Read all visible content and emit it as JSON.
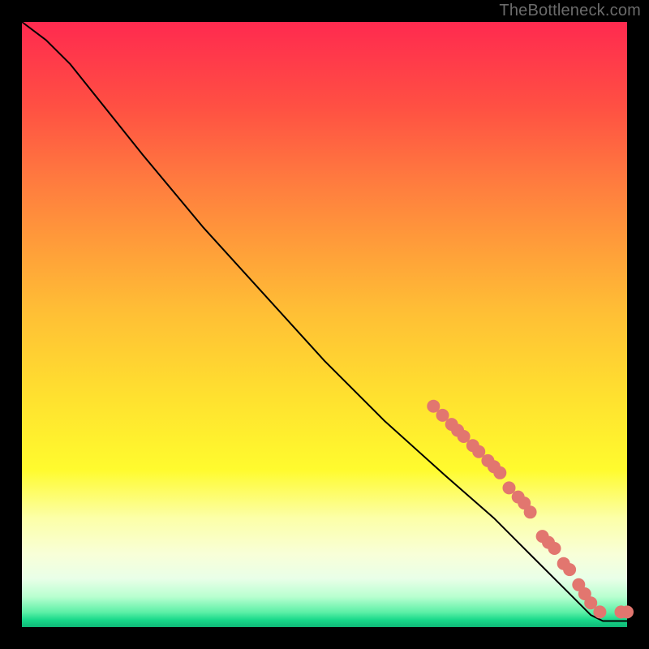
{
  "attribution": "TheBottleneck.com",
  "chart_data": {
    "type": "line",
    "xlim": [
      0,
      100
    ],
    "ylim": [
      0,
      100
    ],
    "title": "",
    "xlabel": "",
    "ylabel": "",
    "curve": [
      {
        "x": 0,
        "y": 100
      },
      {
        "x": 4,
        "y": 97
      },
      {
        "x": 8,
        "y": 93
      },
      {
        "x": 12,
        "y": 88
      },
      {
        "x": 20,
        "y": 78
      },
      {
        "x": 30,
        "y": 66
      },
      {
        "x": 40,
        "y": 55
      },
      {
        "x": 50,
        "y": 44
      },
      {
        "x": 60,
        "y": 34
      },
      {
        "x": 70,
        "y": 25
      },
      {
        "x": 78,
        "y": 18
      },
      {
        "x": 84,
        "y": 12
      },
      {
        "x": 90,
        "y": 6
      },
      {
        "x": 94,
        "y": 2
      },
      {
        "x": 96,
        "y": 1
      },
      {
        "x": 98,
        "y": 1
      },
      {
        "x": 100,
        "y": 1
      }
    ],
    "markers": [
      {
        "x": 68.0,
        "y": 36.5
      },
      {
        "x": 69.5,
        "y": 35.0
      },
      {
        "x": 71.0,
        "y": 33.5
      },
      {
        "x": 72.0,
        "y": 32.5
      },
      {
        "x": 73.0,
        "y": 31.5
      },
      {
        "x": 74.5,
        "y": 30.0
      },
      {
        "x": 75.5,
        "y": 29.0
      },
      {
        "x": 77.0,
        "y": 27.5
      },
      {
        "x": 78.0,
        "y": 26.5
      },
      {
        "x": 79.0,
        "y": 25.5
      },
      {
        "x": 80.5,
        "y": 23.0
      },
      {
        "x": 82.0,
        "y": 21.5
      },
      {
        "x": 83.0,
        "y": 20.5
      },
      {
        "x": 84.0,
        "y": 19.0
      },
      {
        "x": 86.0,
        "y": 15.0
      },
      {
        "x": 87.0,
        "y": 14.0
      },
      {
        "x": 88.0,
        "y": 13.0
      },
      {
        "x": 89.5,
        "y": 10.5
      },
      {
        "x": 90.5,
        "y": 9.5
      },
      {
        "x": 92.0,
        "y": 7.0
      },
      {
        "x": 93.0,
        "y": 5.5
      },
      {
        "x": 94.0,
        "y": 4.0
      },
      {
        "x": 95.5,
        "y": 2.5
      },
      {
        "x": 99.0,
        "y": 2.5
      },
      {
        "x": 100.0,
        "y": 2.5
      }
    ],
    "marker_color": "#e2766f",
    "curve_color": "#000000"
  }
}
